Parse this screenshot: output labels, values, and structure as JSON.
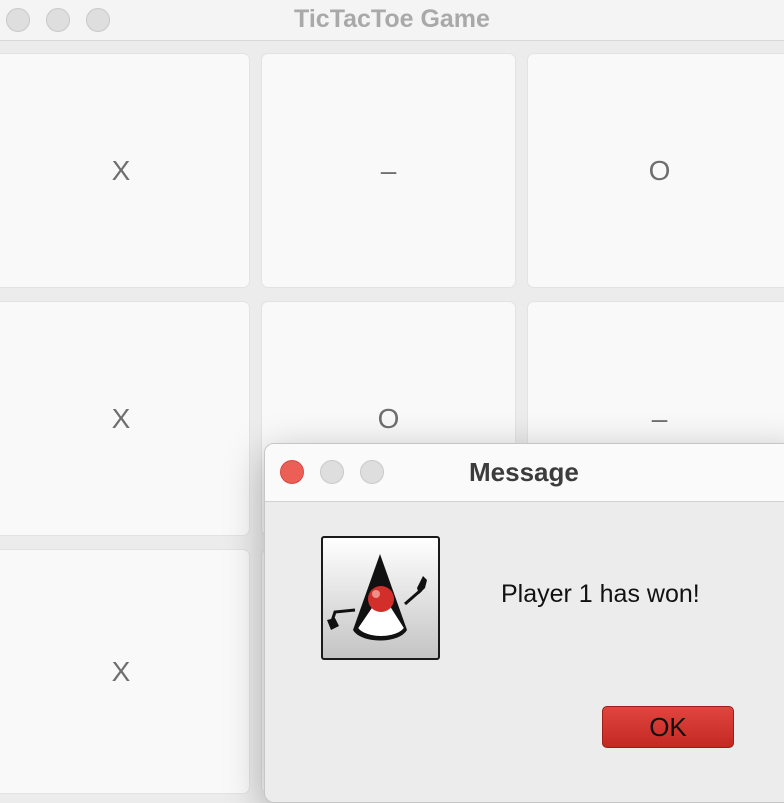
{
  "window": {
    "title": "TicTacToe Game"
  },
  "board": {
    "cells": [
      "X",
      "–",
      "O",
      "X",
      "O",
      "–",
      "X",
      "",
      ""
    ]
  },
  "dialog": {
    "title": "Message",
    "message": "Player 1 has won!",
    "ok_label": "OK",
    "icon": "java-duke-icon"
  },
  "colors": {
    "close": "#ec5f57",
    "ok_button": "#d13a33"
  }
}
